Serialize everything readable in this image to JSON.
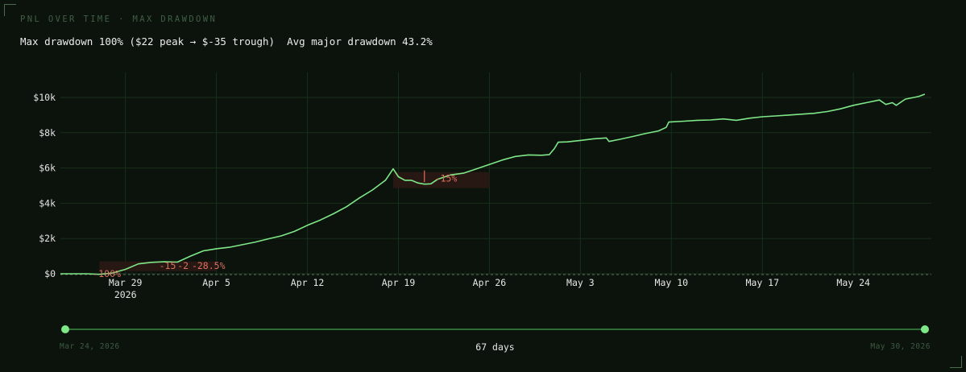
{
  "header": {
    "title": "PNL OVER TIME · MAX DRAWDOWN",
    "summary": "Max drawdown 100% ($22 peak → $-35 trough)  Avg major drawdown 43.2%"
  },
  "colors": {
    "background": "#0c130d",
    "line": "#7ee787",
    "grid": "#17301b",
    "drawdown": "#e0705e",
    "drawdown_band": "#2a1a14",
    "handle": "#7ee787"
  },
  "chart_data": {
    "type": "line",
    "title": "",
    "xlabel": "",
    "ylabel": "",
    "ylim": [
      0,
      10500
    ],
    "y_ticks": [
      {
        "value": 0,
        "label": "$0"
      },
      {
        "value": 2000,
        "label": "$2k"
      },
      {
        "value": 4000,
        "label": "$4k"
      },
      {
        "value": 6000,
        "label": "$6k"
      },
      {
        "value": 8000,
        "label": "$8k"
      },
      {
        "value": 10000,
        "label": "$10k"
      }
    ],
    "x_ticks": [
      {
        "day": 5,
        "label": "Mar 29",
        "sublabel": "2026"
      },
      {
        "day": 12,
        "label": "Apr 5",
        "sublabel": ""
      },
      {
        "day": 19,
        "label": "Apr 12",
        "sublabel": ""
      },
      {
        "day": 26,
        "label": "Apr 19",
        "sublabel": ""
      },
      {
        "day": 33,
        "label": "Apr 26",
        "sublabel": ""
      },
      {
        "day": 40,
        "label": "May 3",
        "sublabel": ""
      },
      {
        "day": 47,
        "label": "May 10",
        "sublabel": ""
      },
      {
        "day": 54,
        "label": "May 17",
        "sublabel": ""
      },
      {
        "day": 61,
        "label": "May 24",
        "sublabel": ""
      }
    ],
    "series": [
      {
        "values": [
          [
            0,
            0
          ],
          [
            1,
            0
          ],
          [
            2,
            0
          ],
          [
            3,
            -30
          ],
          [
            4,
            40
          ],
          [
            5,
            250
          ],
          [
            6,
            560
          ],
          [
            7,
            650
          ],
          [
            8,
            680
          ],
          [
            9,
            660
          ],
          [
            10,
            1000
          ],
          [
            11,
            1300
          ],
          [
            12,
            1420
          ],
          [
            13,
            1500
          ],
          [
            14,
            1650
          ],
          [
            15,
            1800
          ],
          [
            16,
            1980
          ],
          [
            17,
            2150
          ],
          [
            18,
            2400
          ],
          [
            19,
            2750
          ],
          [
            20,
            3050
          ],
          [
            21,
            3400
          ],
          [
            22,
            3800
          ],
          [
            23,
            4300
          ],
          [
            24,
            4750
          ],
          [
            25,
            5300
          ],
          [
            25.6,
            5950
          ],
          [
            26,
            5500
          ],
          [
            26.5,
            5300
          ],
          [
            27,
            5300
          ],
          [
            27.5,
            5150
          ],
          [
            28,
            5080
          ],
          [
            28.5,
            5100
          ],
          [
            29,
            5350
          ],
          [
            30,
            5600
          ],
          [
            31,
            5700
          ],
          [
            32,
            5950
          ],
          [
            33,
            6200
          ],
          [
            34,
            6450
          ],
          [
            35,
            6650
          ],
          [
            36,
            6740
          ],
          [
            37,
            6720
          ],
          [
            37.6,
            6750
          ],
          [
            38,
            7100
          ],
          [
            38.3,
            7460
          ],
          [
            39,
            7480
          ],
          [
            40,
            7560
          ],
          [
            41,
            7650
          ],
          [
            42,
            7700
          ],
          [
            42.2,
            7500
          ],
          [
            43,
            7620
          ],
          [
            44,
            7780
          ],
          [
            45,
            7950
          ],
          [
            46,
            8100
          ],
          [
            46.6,
            8300
          ],
          [
            46.8,
            8600
          ],
          [
            48,
            8650
          ],
          [
            49,
            8700
          ],
          [
            50,
            8720
          ],
          [
            51,
            8780
          ],
          [
            52,
            8700
          ],
          [
            53,
            8820
          ],
          [
            54,
            8900
          ],
          [
            55,
            8950
          ],
          [
            56,
            9000
          ],
          [
            57,
            9050
          ],
          [
            58,
            9100
          ],
          [
            59,
            9200
          ],
          [
            60,
            9350
          ],
          [
            61,
            9550
          ],
          [
            62,
            9700
          ],
          [
            63,
            9850
          ],
          [
            63.5,
            9600
          ],
          [
            64,
            9700
          ],
          [
            64.3,
            9550
          ],
          [
            65,
            9900
          ],
          [
            66,
            10050
          ],
          [
            66.5,
            10180
          ]
        ]
      }
    ],
    "drawdowns": [
      {
        "label": "-100%",
        "day": 2.5,
        "value": 0
      },
      {
        "label": "-15",
        "day": 7.6,
        "value": 450
      },
      {
        "label": "-2",
        "day": 9.0,
        "value": 450
      },
      {
        "label": "-28.5%",
        "day": 10.1,
        "value": 450
      },
      {
        "label": "-15%",
        "day": 28.8,
        "value": 5400
      }
    ],
    "range": {
      "start": "Mar 24, 2026",
      "end": "May 30, 2026",
      "days_label": "67 days"
    }
  }
}
